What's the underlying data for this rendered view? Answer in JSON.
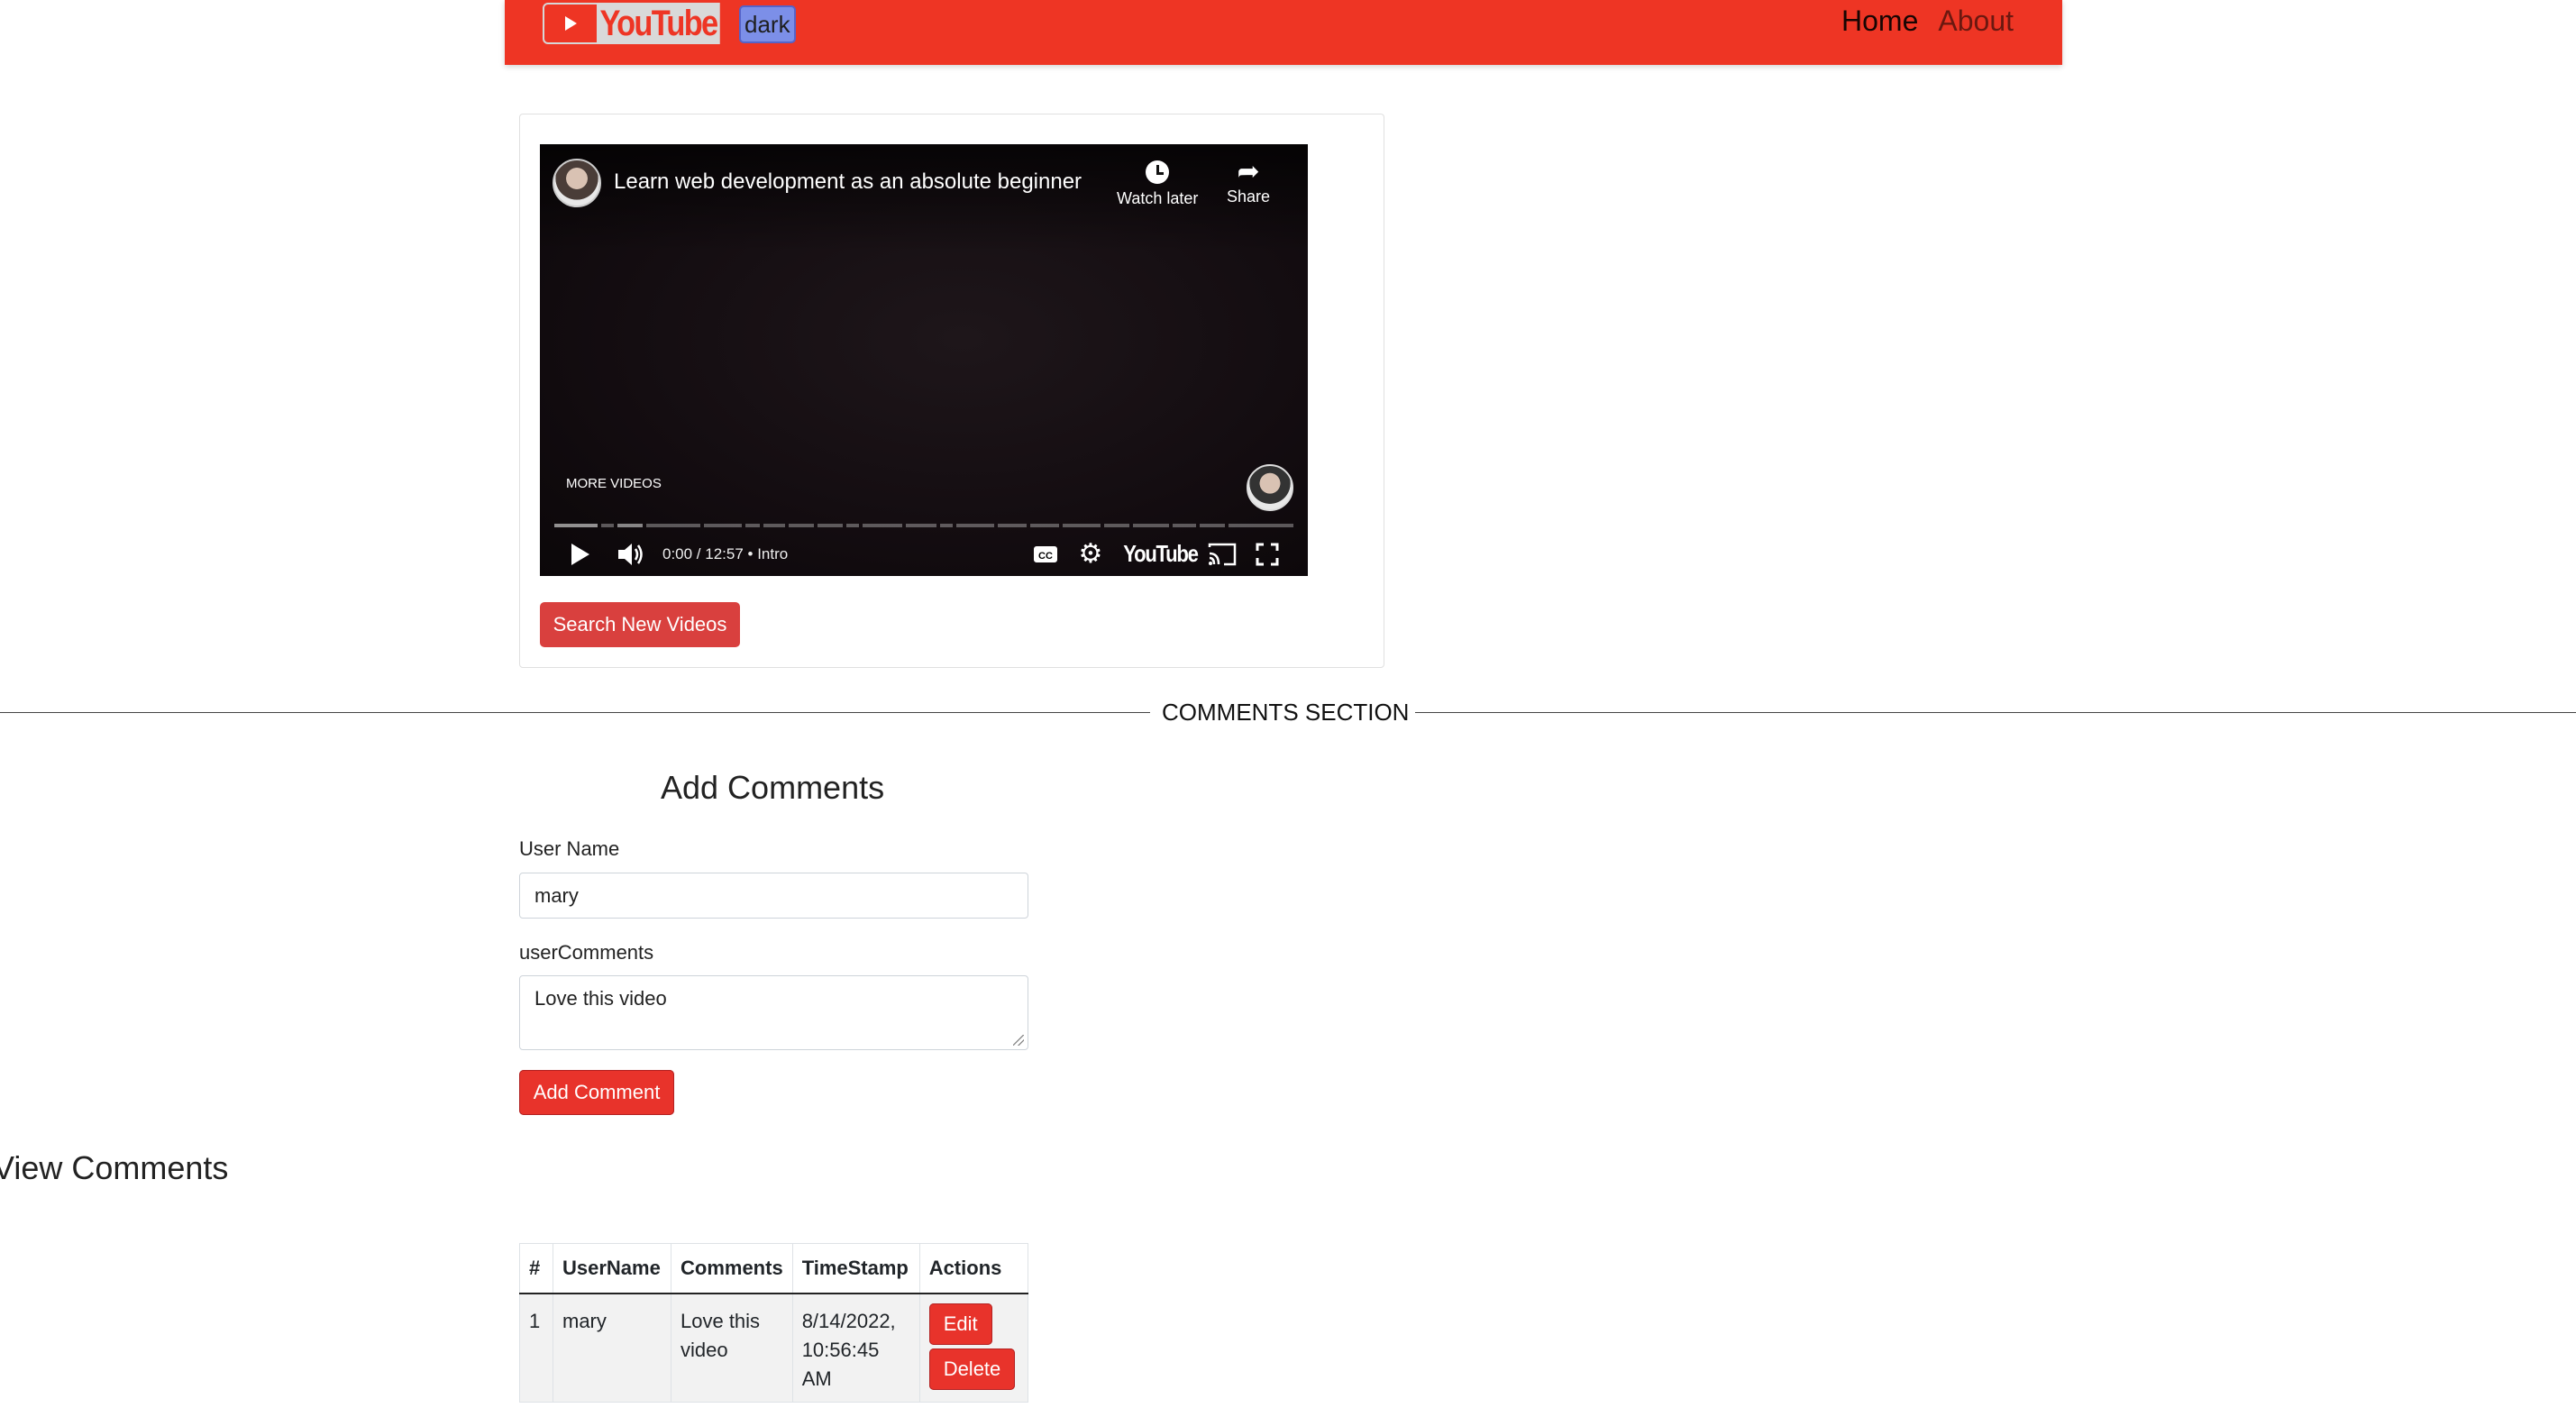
{
  "navbar": {
    "logo_text": "YouTube",
    "dark_toggle_label": "dark",
    "links": [
      {
        "label": "Home",
        "active": true
      },
      {
        "label": "About",
        "active": false
      }
    ],
    "color": "#ee3524"
  },
  "player": {
    "title": "Learn web development as an absolute beginner",
    "watch_later_label": "Watch later",
    "share_label": "Share",
    "more_videos_label": "MORE VIDEOS",
    "time": "0:00 / 12:57 • Intro",
    "cc_label": "CC",
    "brand_label": "YouTube"
  },
  "search_button_label": "Search New Videos",
  "divider_label": "COMMENTS SECTION",
  "add_comments": {
    "title": "Add Comments",
    "username_label": "User Name",
    "username_value": "mary",
    "comments_label": "userComments",
    "comments_value": "Love this video",
    "submit_label": "Add Comment"
  },
  "view_comments": {
    "title": "View Comments",
    "columns": [
      "#",
      "UserName",
      "Comments",
      "TimeStamp",
      "Actions"
    ],
    "rows": [
      {
        "index": "1",
        "username": "mary",
        "comment": "Love this video",
        "timestamp": "8/14/2022, 10:56:45 AM",
        "edit_label": "Edit",
        "delete_label": "Delete"
      }
    ]
  },
  "colors": {
    "accent_red": "#ee3524",
    "button_red": "#e8332b",
    "search_button": "#d9403e"
  }
}
